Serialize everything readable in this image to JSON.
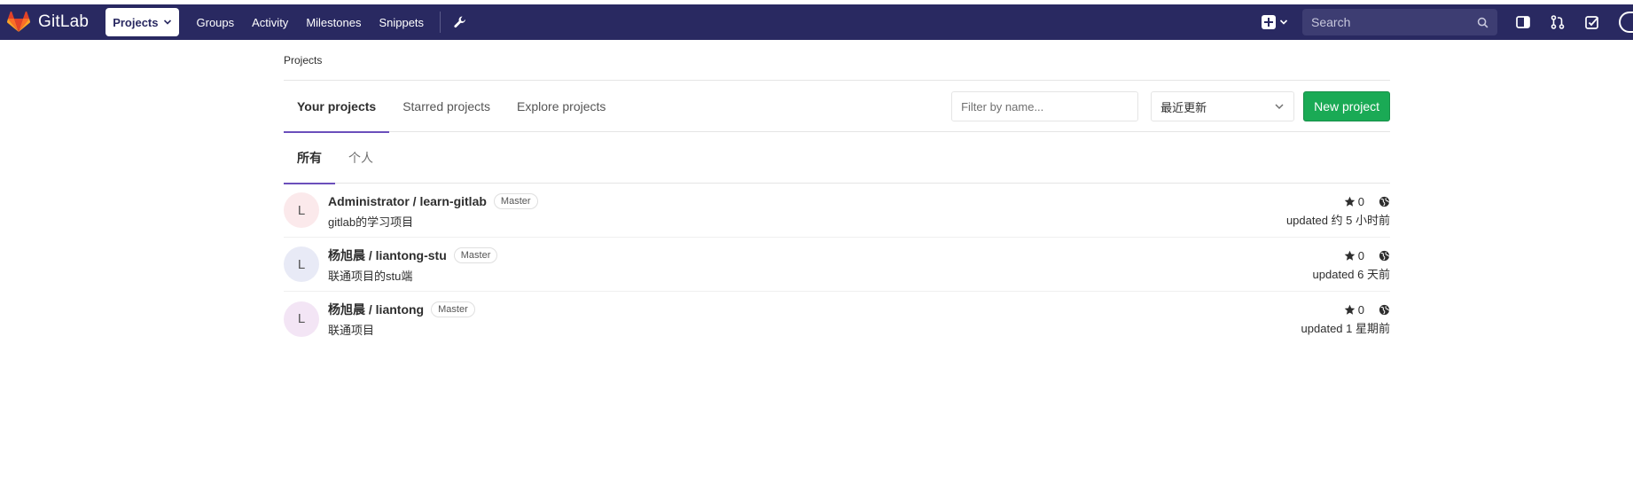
{
  "navbar": {
    "brand": "GitLab",
    "links": [
      "Projects",
      "Groups",
      "Activity",
      "Milestones",
      "Snippets"
    ],
    "search_placeholder": "Search"
  },
  "breadcrumb": "Projects",
  "tabs": [
    "Your projects",
    "Starred projects",
    "Explore projects"
  ],
  "filter_placeholder": "Filter by name...",
  "sort_value": "最近更新",
  "new_project_label": "New project",
  "subtabs": [
    "所有",
    "个人"
  ],
  "colors": {
    "navbar": "#292961",
    "new_button": "#1aaa55",
    "active_tab": "#6b4fbb"
  },
  "projects": [
    {
      "initial": "L",
      "title": "Administrator / learn-gitlab",
      "badge": "Master",
      "description": "gitlab的学习项目",
      "stars": "0",
      "updated": "updated 约 5 小时前",
      "avatar_color": "#fbe9eb"
    },
    {
      "initial": "L",
      "title": "杨旭晨 / liantong-stu",
      "badge": "Master",
      "description": "联通项目的stu端",
      "stars": "0",
      "updated": "updated 6 天前",
      "avatar_color": "#e8eaf6"
    },
    {
      "initial": "L",
      "title": "杨旭晨 / liantong",
      "badge": "Master",
      "description": "联通项目",
      "stars": "0",
      "updated": "updated 1 星期前",
      "avatar_color": "#f3e5f5"
    }
  ]
}
